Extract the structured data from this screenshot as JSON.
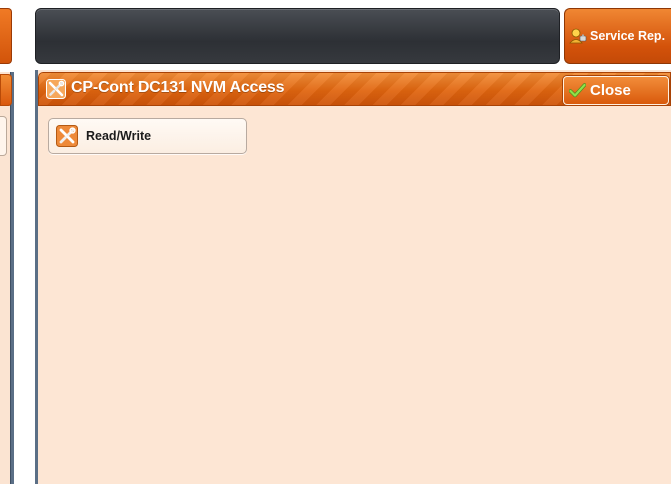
{
  "topbar": {
    "service_button_label": "Service Rep.",
    "service_icon": "service-rep-person-icon"
  },
  "panel": {
    "title": "CP-Cont DC131 NVM Access",
    "title_icon": "tools-icon",
    "close_label": "Close",
    "close_icon": "checkmark-icon"
  },
  "menu": {
    "items": [
      {
        "label": "Read/Write",
        "icon": "tools-icon"
      }
    ]
  },
  "colors": {
    "accent_orange": "#e0650f",
    "panel_background": "#fde6d4",
    "frame_blue_gray": "#5b6f86",
    "topbar_dark": "#2d3035",
    "check_green": "#7ccd3a"
  }
}
